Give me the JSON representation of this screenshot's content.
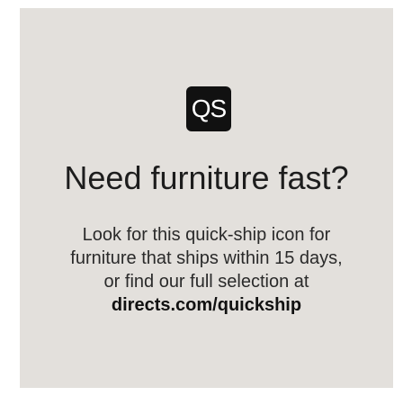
{
  "badge": {
    "text": "QS",
    "icon": "quick-ship-icon",
    "bg": "#111111",
    "fg": "#ffffff"
  },
  "headline": "Need furniture fast?",
  "body": {
    "line1": "Look for this quick-ship icon for",
    "line2": "furniture that ships within 15 days,",
    "line3": "or find our full selection at",
    "link": "directs.com/quickship"
  },
  "colors": {
    "card_bg": "#e3e0dc",
    "text": "#1d1d1d"
  }
}
